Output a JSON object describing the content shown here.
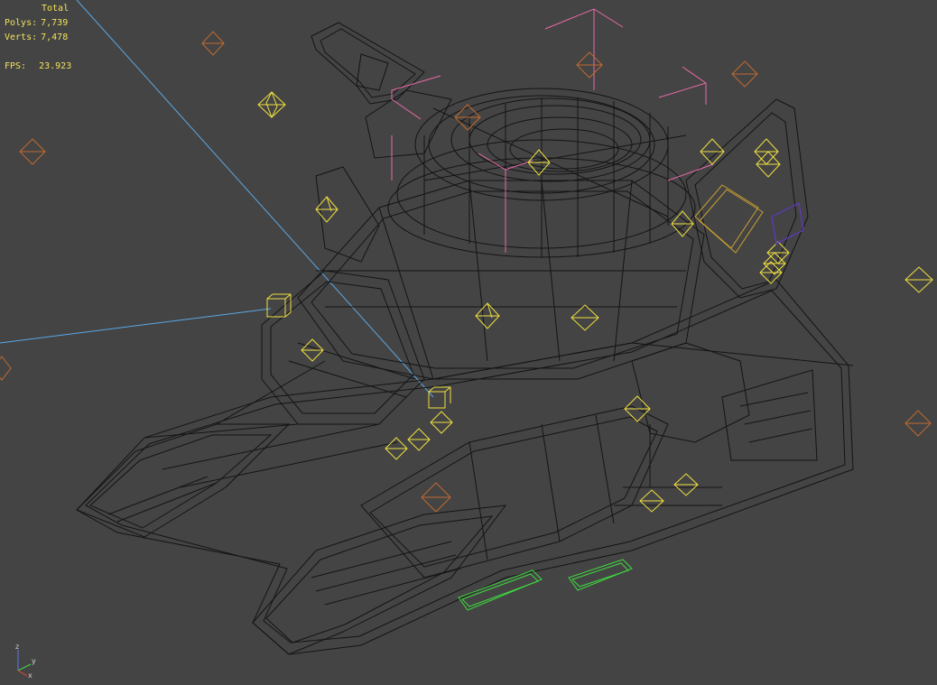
{
  "viewport": {
    "background": "#444444",
    "stats": {
      "title": "Total",
      "polys_label": "Polys:",
      "polys_value": "7,739",
      "verts_label": "Verts:",
      "verts_value": "7,478",
      "fps_label": "FPS:",
      "fps_value": "23.923"
    },
    "axis_gizmo": {
      "x": "x",
      "y": "y",
      "z": "z"
    },
    "colors": {
      "text": "#f2e25a",
      "mesh_wire": "#111111",
      "helper": "#f0e040",
      "light_helper": "#c06a30",
      "camera_bracket": "#e86aa8",
      "selection_green": "#3fd93f",
      "blue_guide": "#5aa8e6",
      "gold_box": "#c8a030",
      "purple_box": "#5a3ab0"
    },
    "icons": [
      "octahedron-helper-icon",
      "light-helper-icon",
      "axis-tripod-icon"
    ]
  }
}
